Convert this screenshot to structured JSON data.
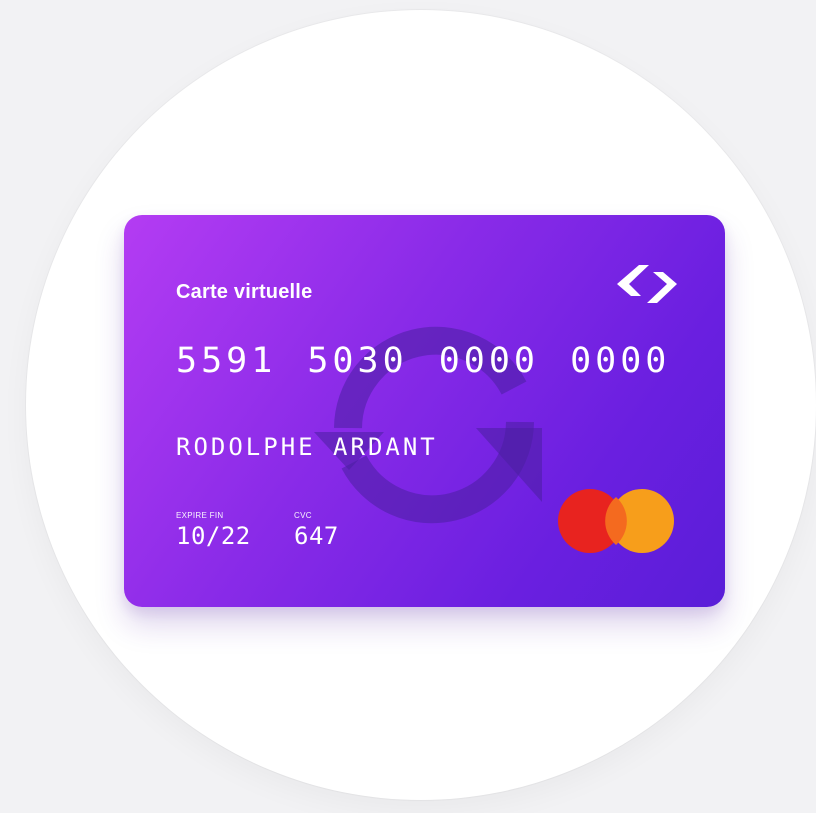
{
  "card": {
    "type_label": "Carte virtuelle",
    "number": "5591 5030 0000 0000",
    "holder": "RODOLPHE ARDANT",
    "expiry_label": "EXPIRE FIN",
    "expiry_value": "10/22",
    "cvc_label": "CVC",
    "cvc_value": "647"
  },
  "icons": {
    "brand": "brand-logo-icon",
    "overlay": "refresh-icon",
    "network": "mastercard-logo-icon"
  },
  "colors": {
    "card_gradient_start": "#b43cf3",
    "card_gradient_end": "#5a1ed8",
    "mastercard_red": "#e8231f",
    "mastercard_orange": "#f79e1b"
  }
}
